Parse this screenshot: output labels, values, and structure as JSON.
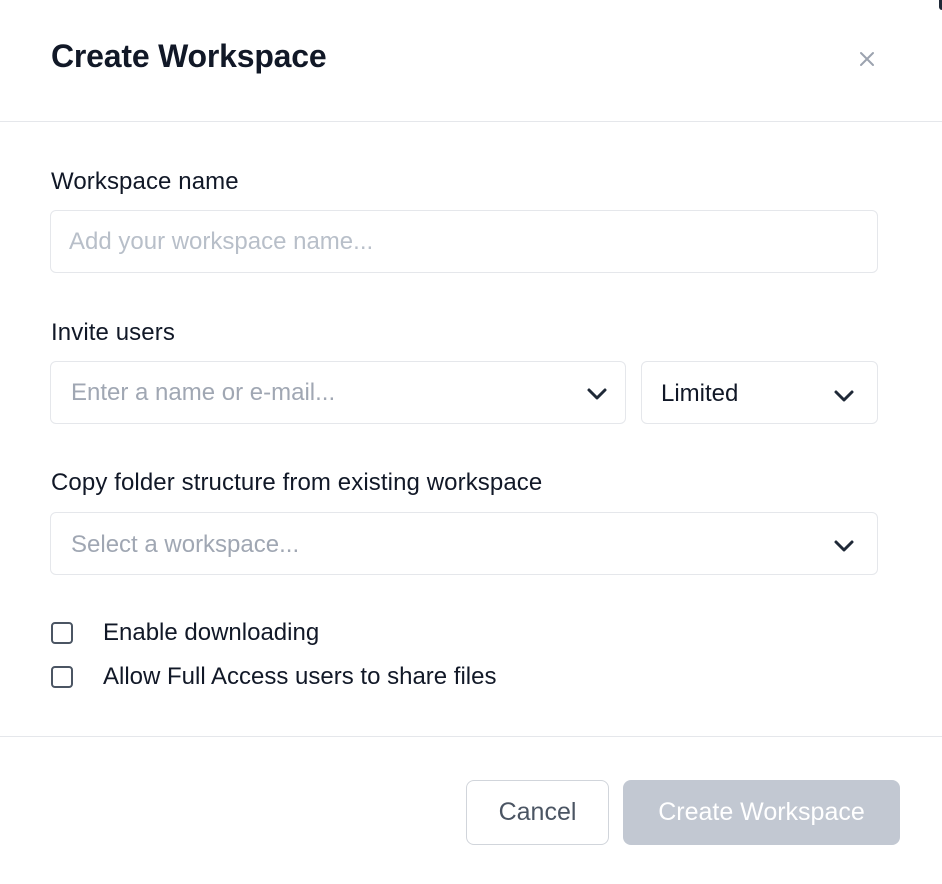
{
  "dialog": {
    "title": "Create Workspace",
    "close_icon": "close-icon"
  },
  "form": {
    "workspace_name": {
      "label": "Workspace name",
      "placeholder": "Add your workspace name...",
      "value": ""
    },
    "invite_users": {
      "label": "Invite users",
      "placeholder": "Enter a name or e-mail...",
      "role_value": "Limited"
    },
    "copy_structure": {
      "label": "Copy folder structure from existing workspace",
      "placeholder": "Select a workspace..."
    },
    "options": [
      {
        "label": "Enable downloading",
        "checked": false
      },
      {
        "label": "Allow Full Access users to share files",
        "checked": false
      }
    ]
  },
  "footer": {
    "cancel_label": "Cancel",
    "create_label": "Create Workspace"
  },
  "colors": {
    "text": "#111827",
    "border": "#e5e7eb",
    "placeholder": "#a0a7b3",
    "disabled_button": "#c2c8d2"
  }
}
